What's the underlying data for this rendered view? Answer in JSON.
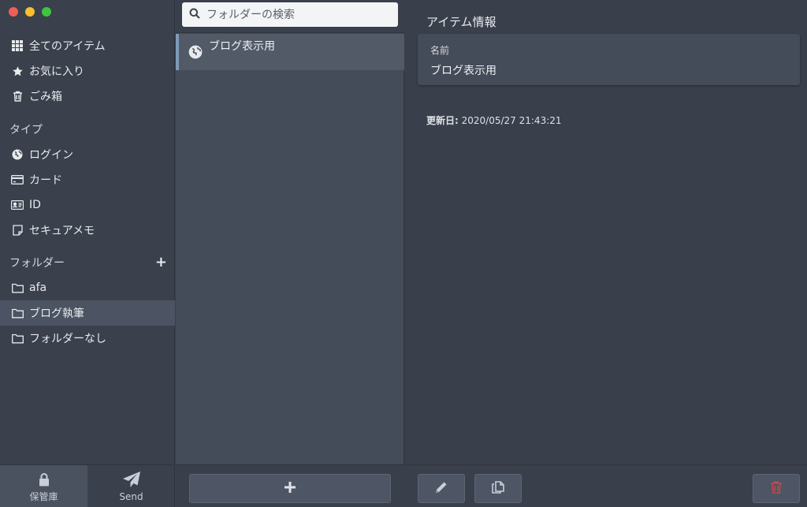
{
  "sidebar": {
    "window_controls": [
      "close",
      "minimize",
      "maximize"
    ],
    "vault_filters": [
      {
        "icon": "grid-icon",
        "label": "全てのアイテム"
      },
      {
        "icon": "star-icon",
        "label": "お気に入り"
      },
      {
        "icon": "trash-icon",
        "label": "ごみ箱"
      }
    ],
    "types_heading": "タイプ",
    "types": [
      {
        "icon": "globe-icon",
        "label": "ログイン"
      },
      {
        "icon": "card-icon",
        "label": "カード"
      },
      {
        "icon": "id-card-icon",
        "label": "ID"
      },
      {
        "icon": "note-icon",
        "label": "セキュアメモ"
      }
    ],
    "folders_heading": "フォルダー",
    "folders": [
      {
        "icon": "folder-icon",
        "label": "afa",
        "selected": false
      },
      {
        "icon": "folder-icon",
        "label": "ブログ執筆",
        "selected": true
      },
      {
        "icon": "folder-icon",
        "label": "フォルダーなし",
        "selected": false
      }
    ],
    "bottom_tabs": [
      {
        "icon": "lock-icon",
        "label": "保管庫",
        "active": true
      },
      {
        "icon": "send-icon",
        "label": "Send",
        "active": false
      }
    ]
  },
  "list": {
    "search_placeholder": "フォルダーの検索",
    "items": [
      {
        "icon": "globe-icon",
        "name": "ブログ表示用",
        "selected": true
      }
    ]
  },
  "detail": {
    "section_title": "アイテム情報",
    "name_label": "名前",
    "name_value": "ブログ表示用",
    "updated_label": "更新日:",
    "updated_value": "2020/05/27 21:43:21"
  },
  "colors": {
    "selected_accent": "#7f9ab8",
    "delete_red": "#c6464b"
  }
}
